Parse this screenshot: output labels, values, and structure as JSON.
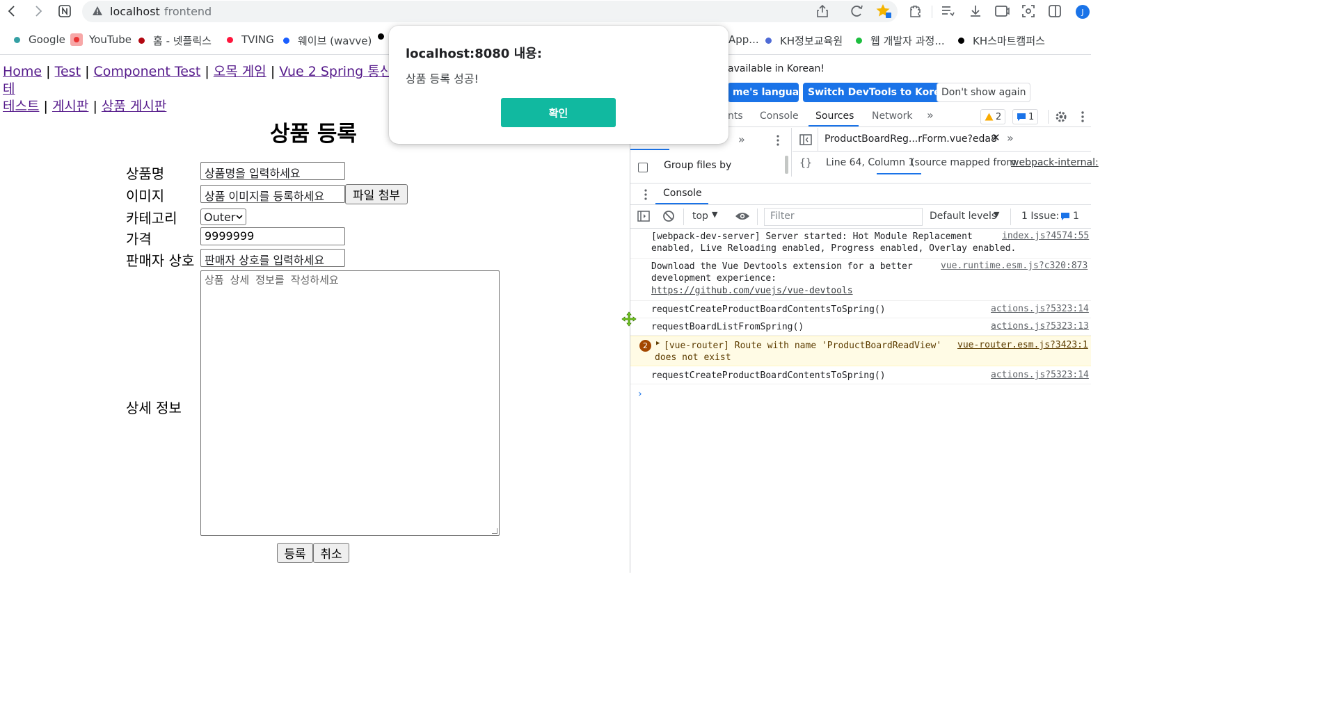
{
  "browser": {
    "url_host": "localhost",
    "url_path": "frontend",
    "profile_initial": "J"
  },
  "bookmarks": [
    {
      "label": "Google",
      "color": "#34a853"
    },
    {
      "label": "YouTube",
      "color": "#ea3333"
    },
    {
      "label": "홈 - 넷플릭스",
      "color": "#b20710"
    },
    {
      "label": "TVING",
      "color": "#ff153c"
    },
    {
      "label": "웨이브 (wavve)",
      "color": "#1a5eff"
    },
    {
      "label": "App...",
      "color": "#000000"
    },
    {
      "label": "KH정보교육원",
      "color": "#4f6bd6"
    },
    {
      "label": "웹 개발자 과정...",
      "color": "#1dbe3f"
    },
    {
      "label": "KH스마트캠퍼스",
      "color": "#000000"
    }
  ],
  "nav": {
    "links": [
      "Home",
      "Test",
      "Component Test",
      "오목 게임",
      "Vue 2 Spring 통신 테",
      "테스트",
      "게시판",
      "상품 게시판"
    ],
    "separator": "|"
  },
  "form": {
    "title": "상품 등록",
    "name_label": "상품명",
    "name_placeholder": "상품명을 입력하세요",
    "image_label": "이미지",
    "image_placeholder": "상품 이미지를 등록하세요",
    "attach_button": "파일 첨부",
    "category_label": "카테고리",
    "category_value": "Outer",
    "price_label": "가격",
    "price_value": "9999999",
    "seller_label": "판매자 상호",
    "seller_placeholder": "판매자 상호를 입력하세요",
    "detail_label": "상세 정보",
    "detail_placeholder": "상품 상세 정보를 작성하세요",
    "submit_button": "등록",
    "cancel_button": "취소"
  },
  "alert": {
    "title": "localhost:8080 내용:",
    "message": "상품 등록 성공!",
    "ok_button": "확인",
    "ok_color": "#11b9a0"
  },
  "devtools": {
    "infobar_message": "available in Korean!",
    "infobar_match_button": "me's language",
    "infobar_switch_button": "Switch DevTools to Korean",
    "infobar_dismiss_button": "Don't show again",
    "tabs": [
      "nts",
      "Console",
      "Sources",
      "Network"
    ],
    "active_tab": "Sources",
    "warning_count": "2",
    "message_count": "1",
    "sources_group_label": "Group files by",
    "sources_file_tab": "ProductBoardReg...rForm.vue?eda8",
    "sources_status": "Line 64, Column 1",
    "sources_mapped": "(source mapped from",
    "sources_mapped_link": "webpack-internal:",
    "drawer_tab": "Console",
    "context": "top",
    "filter_placeholder": "Filter",
    "levels": "Default levels",
    "issues_label": "1 Issue:",
    "issues_count": "1",
    "logs": [
      {
        "line1": "[webpack-dev-server] Server started: Hot Module Replacement",
        "line2": "enabled, Live Reloading enabled, Progress enabled, Overlay enabled.",
        "source": "index.js?4574:55"
      },
      {
        "line1": "Download the Vue Devtools extension for a better",
        "line2": "development experience:",
        "line3": "https://github.com/vuejs/vue-devtools",
        "source": "vue.runtime.esm.js?c320:873"
      },
      {
        "line1": "requestCreateProductBoardContentsToSpring()",
        "source": "actions.js?5323:14"
      },
      {
        "line1": "requestBoardListFromSpring()",
        "source": "actions.js?5323:13"
      },
      {
        "count": "2",
        "line1": "[vue-router] Route with name 'ProductBoardReadView'",
        "line2": "does not exist",
        "source": "vue-router.esm.js?3423:1"
      },
      {
        "line1": "requestCreateProductBoardContentsToSpring()",
        "source": "actions.js?5323:14"
      }
    ]
  }
}
